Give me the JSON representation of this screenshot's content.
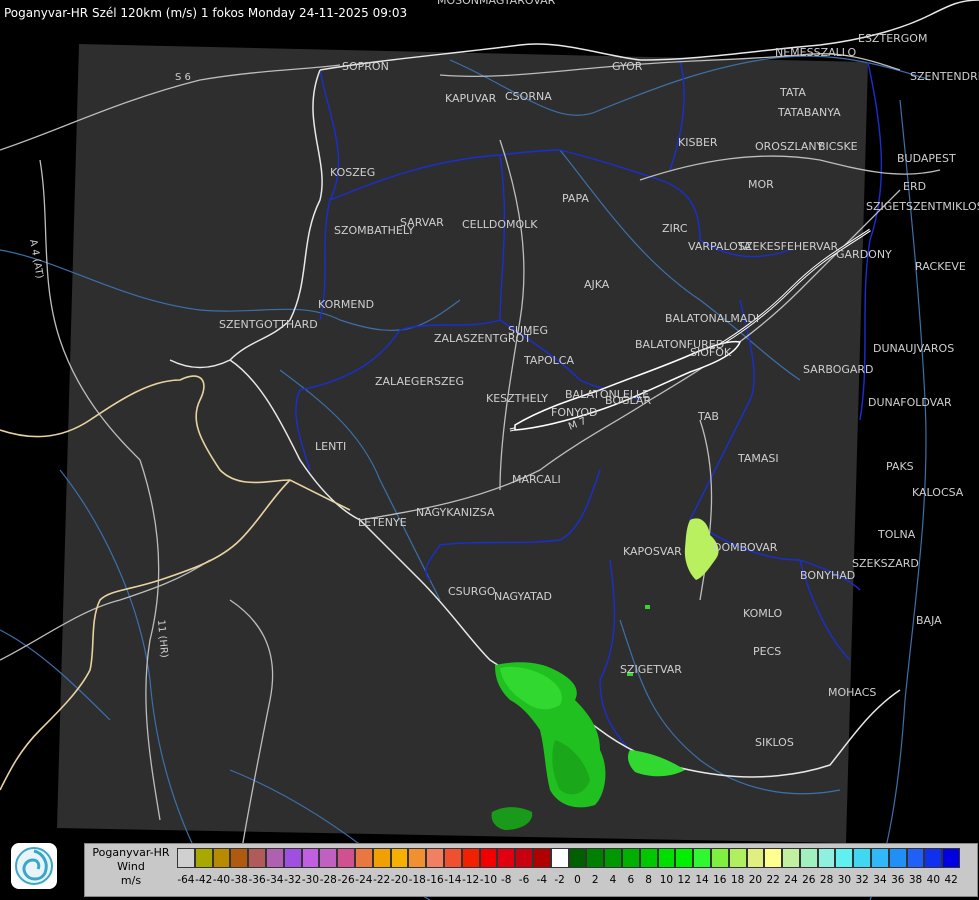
{
  "title": "Poganyvar-HR Szél 120km (m/s) 1 fokos Monday 24-11-2025 09:03",
  "legend": {
    "line1": "Poganyvar-HR",
    "line2": "Wind",
    "line3": "m/s",
    "ticks": [
      "-64",
      "-42",
      "-40",
      "-38",
      "-36",
      "-34",
      "-32",
      "-30",
      "-28",
      "-26",
      "-24",
      "-22",
      "-20",
      "-18",
      "-16",
      "-14",
      "-12",
      "-10",
      "-8",
      "-6",
      "-4",
      "-2",
      "0",
      "2",
      "4",
      "6",
      "8",
      "10",
      "12",
      "14",
      "16",
      "18",
      "20",
      "22",
      "24",
      "26",
      "28",
      "30",
      "32",
      "34",
      "36",
      "38",
      "40",
      "42"
    ],
    "colors": [
      "#d0d0d0",
      "#a8a800",
      "#b88a00",
      "#b05a10",
      "#b05a5a",
      "#b060b0",
      "#a050e0",
      "#c060e0",
      "#c060c0",
      "#d05090",
      "#e87840",
      "#f0a000",
      "#f8b000",
      "#f09030",
      "#f08060",
      "#f05030",
      "#f02000",
      "#f00000",
      "#e00010",
      "#c80010",
      "#b00000",
      "#ffffff",
      "#006000",
      "#008000",
      "#009800",
      "#00b000",
      "#00c800",
      "#00e000",
      "#00f000",
      "#30f830",
      "#80f040",
      "#b0f060",
      "#e0f080",
      "#ffff90",
      "#c0f0a0",
      "#a0f0c0",
      "#90f0e0",
      "#60f0f0",
      "#40d8f0",
      "#30b8f8",
      "#2090f8",
      "#2060f8",
      "#1030f0",
      "#0000e0"
    ]
  },
  "cities": [
    "MOSONMAGYAROVAR",
    "ESZTERGOM",
    "NEMESSZALLO",
    "SOPRON",
    "GYOR",
    "SZENTENDRE",
    "KAPUVAR",
    "CSORNA",
    "TATA",
    "TATABANYA",
    "KISBER",
    "OROSZLANY",
    "BICSKE",
    "BUDAPEST",
    "ERD",
    "MOR",
    "SZIGETSZENTMIKLOS",
    "KOSZEG",
    "PAPA",
    "SARVAR",
    "CELLDOMOLK",
    "ZIRC",
    "SZOMBATHELY",
    "VARPALOTA",
    "SZEKESFEHERVAR",
    "GARDONY",
    "RACKEVE",
    "AJKA",
    "KORMEND",
    "BALATONALMADI",
    "SZENTGOTTHARD",
    "SUMEG",
    "ZALASZENTGROT",
    "BALATONFURED",
    "DUNAUJVAROS",
    "TAPOLCA",
    "SIOFOK",
    "SARBOGARD",
    "ZALAEGERSZEG",
    "BALATONLELLE",
    "KESZTHELY",
    "FONYOD",
    "BOGLAR",
    "DUNAFOLDVAR",
    "TAB",
    "LENTI",
    "TAMASI",
    "PAKS",
    "MARCALI",
    "KALOCSA",
    "NAGYKANIZSA",
    "LETENYE",
    "TOLNA",
    "KAPOSVAR",
    "DOMBOVAR",
    "SZEKSZARD",
    "BONYHAD",
    "CSURGO",
    "NAGYATAD",
    "KOMLO",
    "BAJA",
    "PECS",
    "SZIGETVAR",
    "MOHACS",
    "SIKLOS"
  ],
  "roads": [
    "S 6",
    "A 4 (AT)",
    "11 (HR)",
    "M 7"
  ]
}
